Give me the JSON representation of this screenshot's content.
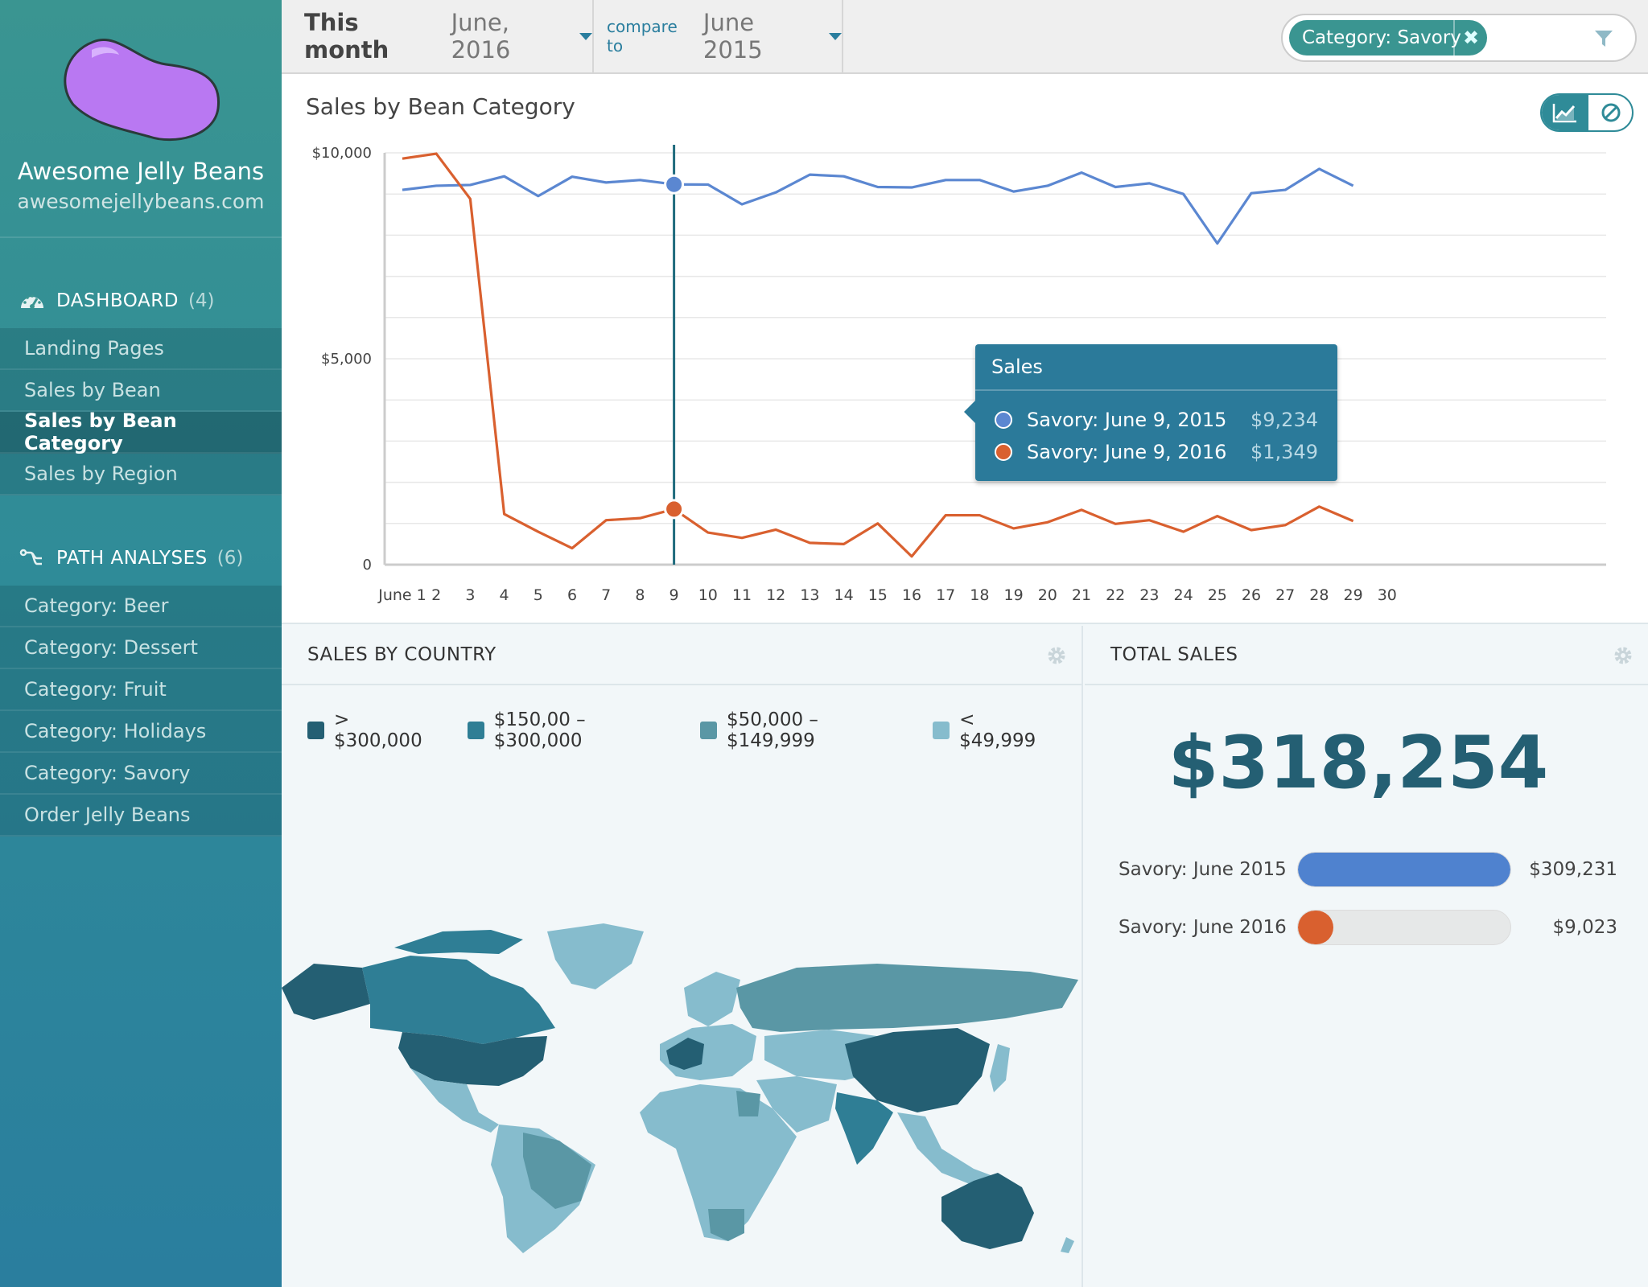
{
  "sidebar": {
    "app_name": "Awesome Jelly Beans",
    "app_url": "awesomejellybeans.com",
    "dashboard": {
      "title": "DASHBOARD",
      "count": "(4)",
      "icon": "dashboard-gauge-icon",
      "items": [
        {
          "label": "Landing Pages",
          "active": false
        },
        {
          "label": "Sales by Bean",
          "active": false
        },
        {
          "label": "Sales by Bean Category",
          "active": true
        },
        {
          "label": "Sales by Region",
          "active": false
        }
      ]
    },
    "paths": {
      "title": "PATH ANALYSES",
      "count": "(6)",
      "icon": "path-analysis-icon",
      "items": [
        {
          "label": "Category: Beer"
        },
        {
          "label": "Category: Dessert"
        },
        {
          "label": "Category: Fruit"
        },
        {
          "label": "Category: Holidays"
        },
        {
          "label": "Category: Savory"
        },
        {
          "label": "Order Jelly Beans"
        }
      ]
    }
  },
  "topbar": {
    "period_label": "This month",
    "period_value": "June, 2016",
    "compare_label": "compare to",
    "compare_value": "June 2015",
    "filter_chip": "Category: Savory"
  },
  "chart": {
    "title": "Sales by Bean Category",
    "tooltip": {
      "title": "Sales",
      "rows": [
        {
          "label": "Savory: June 9, 2015",
          "value": "$9,234",
          "color": "#5b87d1"
        },
        {
          "label": "Savory: June 9, 2016",
          "value": "$1,349",
          "color": "#d9602f"
        }
      ]
    }
  },
  "chart_data": {
    "type": "line",
    "title": "Sales by Bean Category",
    "x_tick_labels": [
      "June 1",
      "2",
      "3",
      "4",
      "5",
      "6",
      "7",
      "8",
      "9",
      "10",
      "11",
      "12",
      "13",
      "14",
      "15",
      "16",
      "17",
      "18",
      "19",
      "20",
      "21",
      "22",
      "23",
      "24",
      "25",
      "26",
      "27",
      "28",
      "29",
      "30"
    ],
    "y_tick_labels": [
      "$10,000",
      "$5,000",
      "0"
    ],
    "ylim": [
      0,
      10000
    ],
    "grid": true,
    "highlight_day": 9,
    "series": [
      {
        "name": "Savory: June 2015",
        "color": "#5b87d1",
        "values": [
          9100,
          9200,
          9220,
          9430,
          8950,
          9420,
          9280,
          9340,
          9234,
          9230,
          8750,
          9040,
          9470,
          9430,
          9170,
          9160,
          9340,
          9340,
          9060,
          9200,
          9520,
          9170,
          9260,
          9000,
          7800,
          9020,
          9100,
          9610,
          9200
        ]
      },
      {
        "name": "Savory: June 2016",
        "color": "#d9602f",
        "values": [
          9860,
          9980,
          8880,
          1230,
          800,
          400,
          1080,
          1130,
          1349,
          780,
          650,
          850,
          530,
          500,
          1000,
          200,
          1200,
          1200,
          880,
          1030,
          1330,
          990,
          1080,
          800,
          1180,
          840,
          960,
          1410,
          1060
        ]
      }
    ]
  },
  "country": {
    "title": "SALES BY COUNTRY",
    "legend": [
      {
        "label": "> $300,000",
        "color": "#245f73"
      },
      {
        "label": "$150,00 – $300,000",
        "color": "#2f7e95"
      },
      {
        "label": "$50,000 – $149,999",
        "color": "#5a97a5"
      },
      {
        "label": "< $49,999",
        "color": "#86bccd"
      }
    ]
  },
  "total": {
    "title": "TOTAL SALES",
    "value": "$318,254",
    "rows": [
      {
        "label": "Savory: June 2015",
        "value": "$309,231",
        "fraction": 1.0,
        "color": "#4f82cf"
      },
      {
        "label": "Savory: June 2016",
        "value": "$9,023",
        "fraction": 0.03,
        "color": "#d9602f"
      }
    ]
  }
}
